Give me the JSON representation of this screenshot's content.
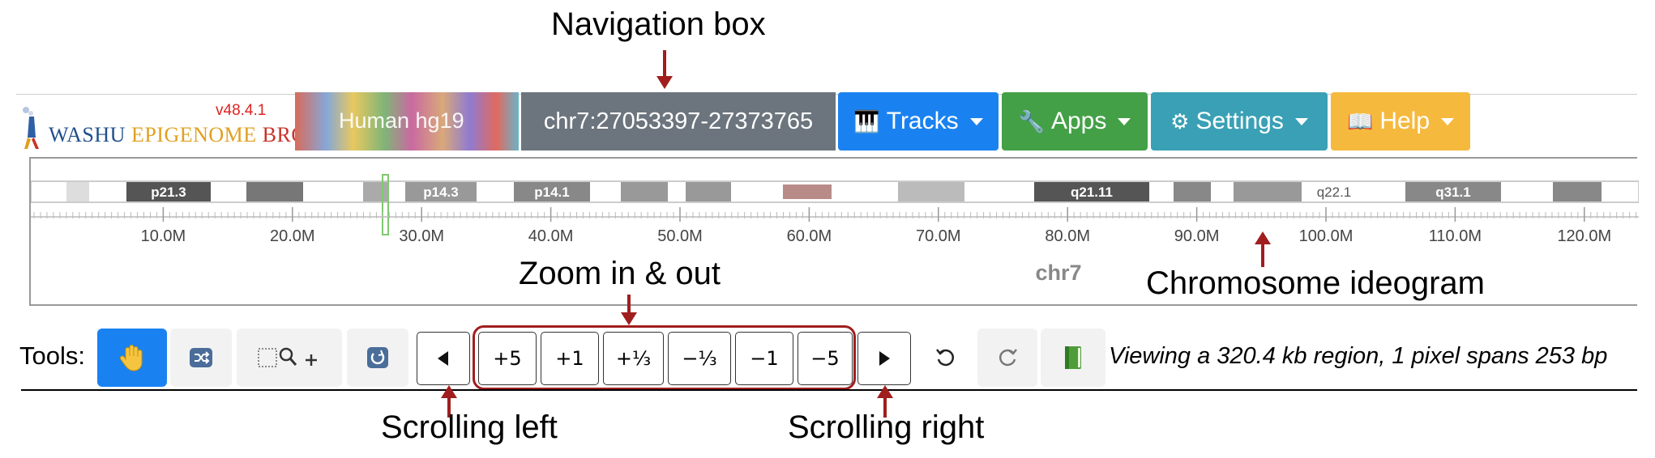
{
  "annotations": {
    "navigation_box": "Navigation box",
    "zoom": "Zoom in & out",
    "chromosome_ideogram": "Chromosome ideogram",
    "scroll_left": "Scrolling left",
    "scroll_right": "Scrolling right"
  },
  "header": {
    "version": "v48.4.1",
    "logo_w": "WASHU ",
    "logo_e": "EPIGENOME ",
    "logo_b": "BROWSER",
    "genome": "Human hg19",
    "locus": "chr7:27053397-27373765",
    "menus": [
      {
        "label": "Tracks",
        "icon": "piano-icon",
        "glyph": "🎹",
        "color": "#1a82f0"
      },
      {
        "label": "Apps",
        "icon": "wrench-icon",
        "glyph": "🔧",
        "color": "#44a047"
      },
      {
        "label": "Settings",
        "icon": "gear-icon",
        "glyph": "⚙",
        "color": "#3aa0b5"
      },
      {
        "label": "Help",
        "icon": "book-icon",
        "glyph": "📖",
        "color": "#f5b93e"
      }
    ]
  },
  "ideogram": {
    "chromosome": "chr7",
    "band_labels": [
      "p21.3",
      "p14.3",
      "p14.1",
      "q21.11",
      "q22.1",
      "q31.1"
    ],
    "axis_ticks": [
      "10.0M",
      "20.0M",
      "30.0M",
      "40.0M",
      "50.0M",
      "60.0M",
      "70.0M",
      "80.0M",
      "90.0M",
      "100.0M",
      "110.0M",
      "120.0M"
    ]
  },
  "tools": {
    "label": "Tools:",
    "zoom_buttons": [
      "+5",
      "+1",
      "+⅓",
      "−⅓",
      "−1",
      "−5"
    ],
    "status": "Viewing a 320.4 kb region, 1 pixel spans 253 bp"
  },
  "colors": {
    "annotation_red": "#a01e1e",
    "drag_tool_active": "#1a82f0",
    "navbox": "#6c757d"
  }
}
